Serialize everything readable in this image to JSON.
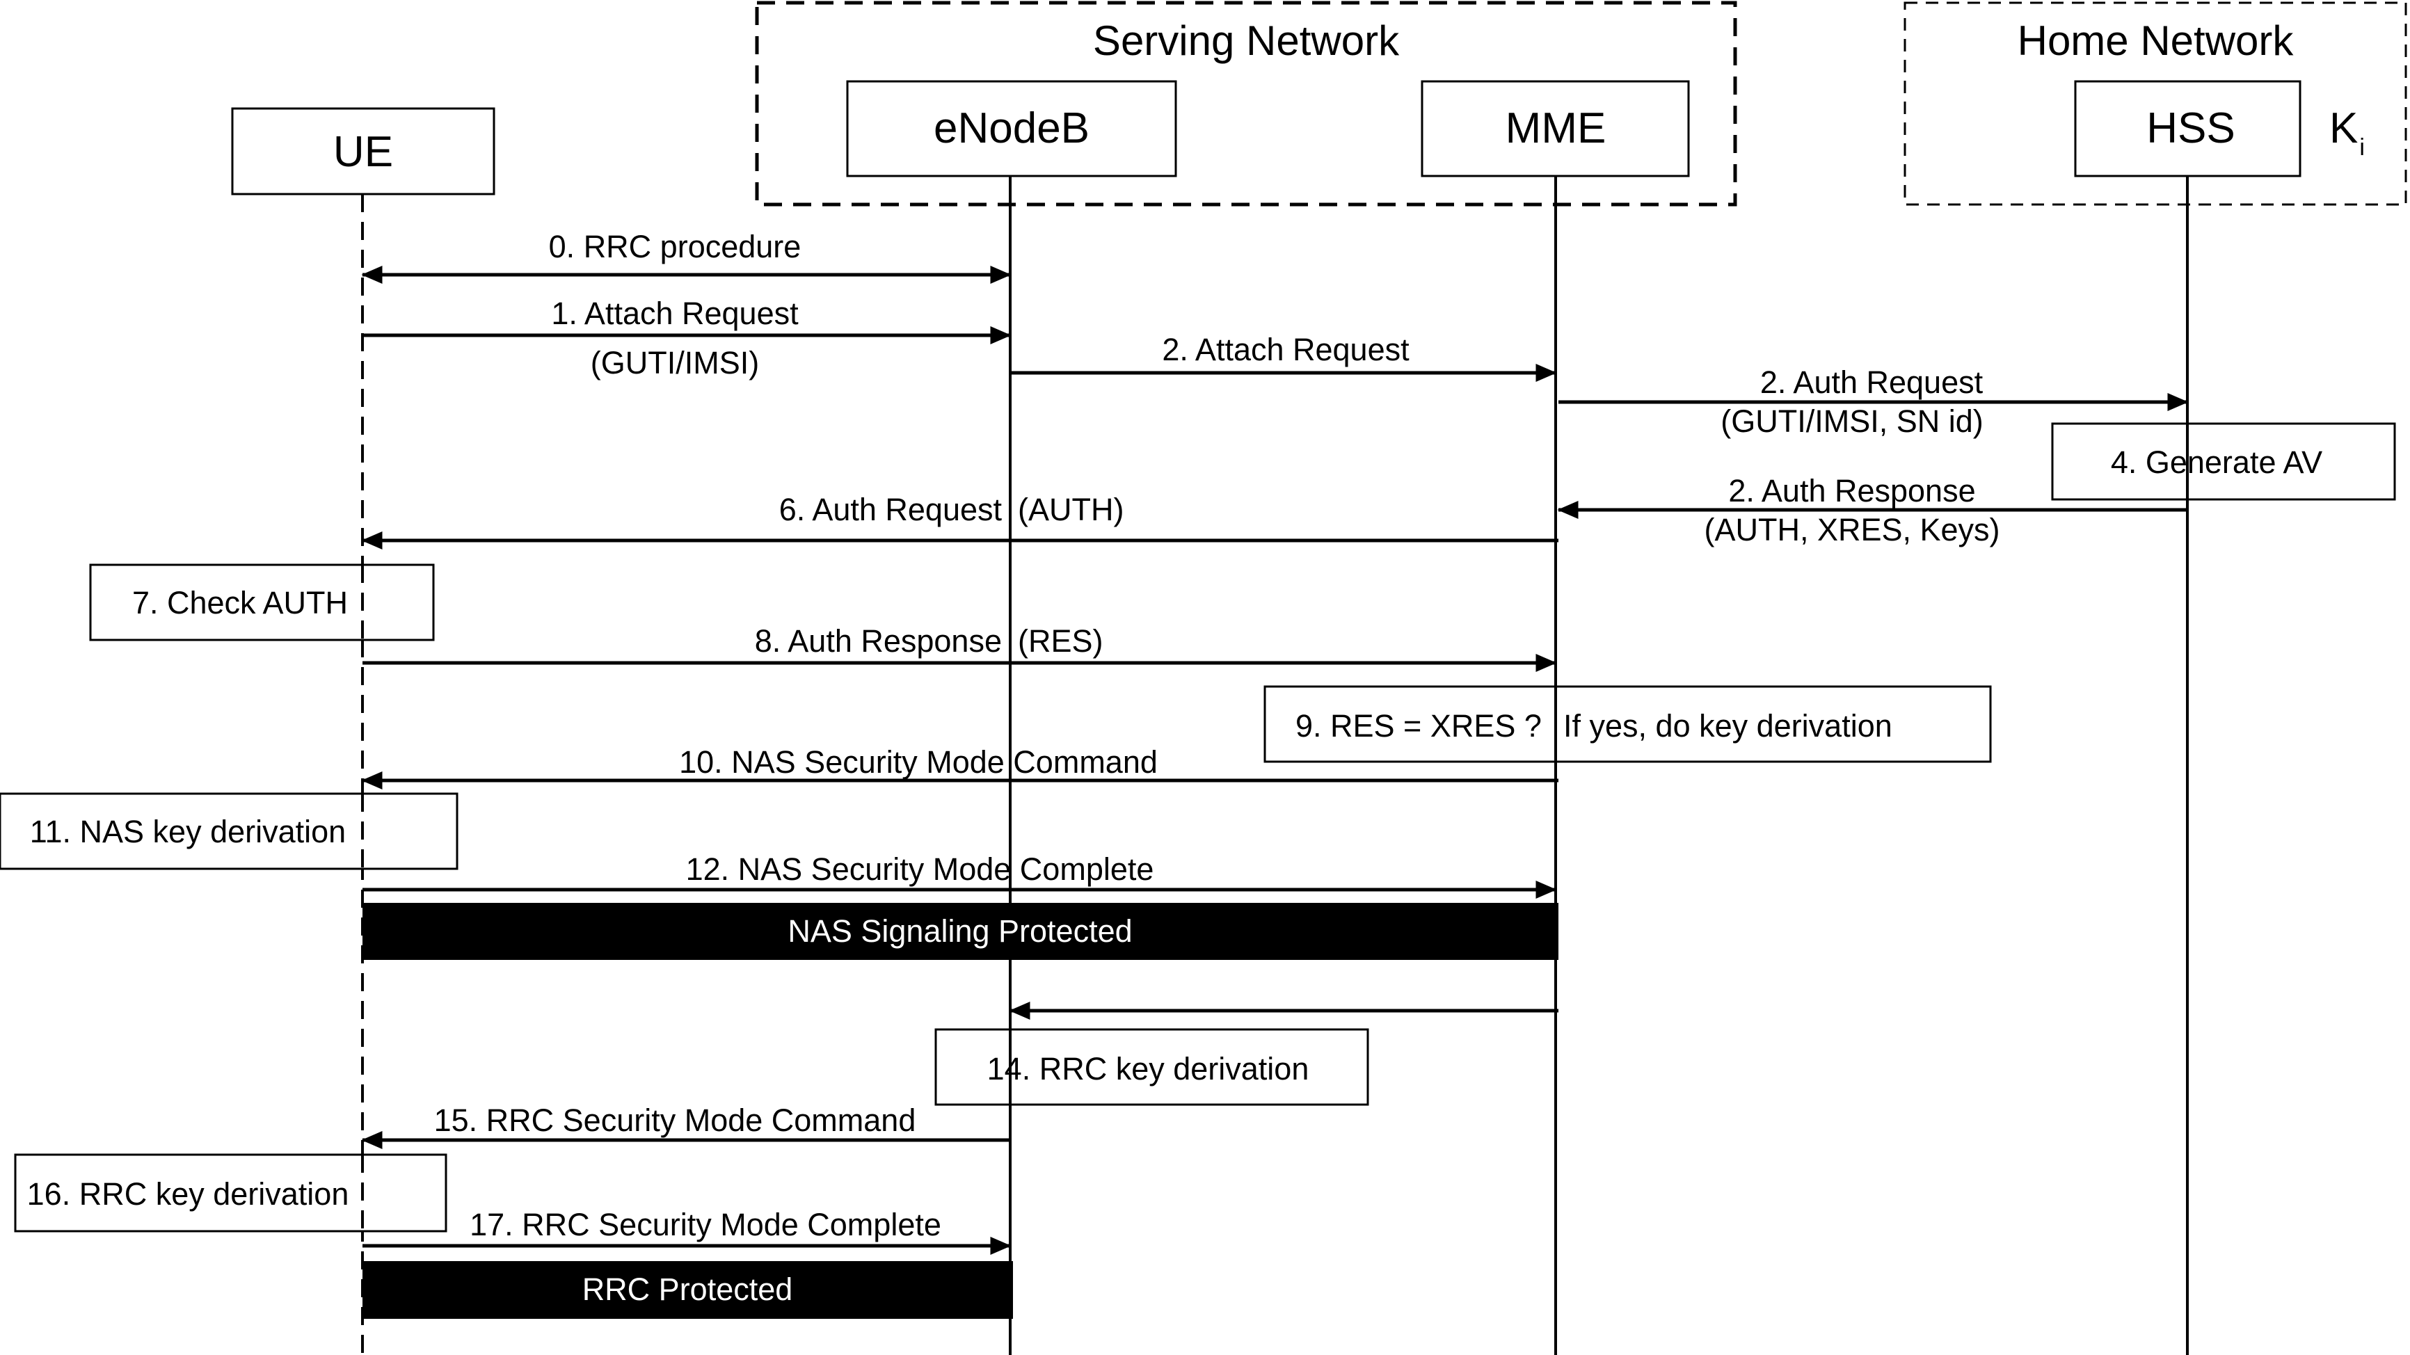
{
  "groups": {
    "serving_network": "Serving Network",
    "home_network": "Home Network"
  },
  "participants": {
    "ue": "UE",
    "enodeb": "eNodeB",
    "mme": "MME",
    "hss": "HSS"
  },
  "hss_key": {
    "main": "K",
    "sub": "i"
  },
  "messages": {
    "m0": "0. RRC procedure",
    "m1": "1. Attach Request",
    "m1_param": "(GUTI/IMSI)",
    "m2a": "2. Attach Request",
    "m2b": "2. Auth Request",
    "m2b_param": "(GUTI/IMSI, SN id)",
    "m2c": "2. Auth Response",
    "m2c_param": "(AUTH, XRES, Keys)",
    "m6": "6. Auth Request",
    "m6_param": "(AUTH)",
    "m8": "8. Auth Response",
    "m8_param": "(RES)",
    "m10": "10. NAS Security Mode Command",
    "m12": "12. NAS Security Mode Complete",
    "m15": "15. RRC Security Mode Command",
    "m17": "17. RRC Security Mode Complete"
  },
  "steps": {
    "s4": "4. Generate AV",
    "s7": "7. Check AUTH",
    "s9a": "9. RES = XRES ?",
    "s9b": "If yes, do key derivation",
    "s11": "11. NAS key derivation",
    "s14": "14. RRC key derivation",
    "s16": "16. RRC key derivation"
  },
  "bands": {
    "nas": "NAS Signaling Protected",
    "rrc": "RRC Protected"
  },
  "colors": {
    "line": "#000000",
    "band_fill": "#000000",
    "band_text": "#ffffff",
    "box_fill": "#ffffff"
  }
}
